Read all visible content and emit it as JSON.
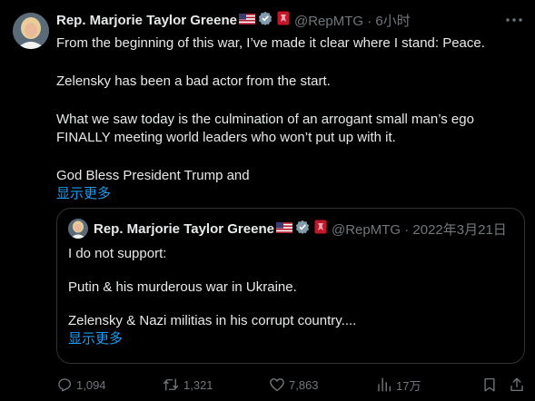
{
  "tweet": {
    "author_name": "Rep. Marjorie Taylor Greene",
    "flag_emoji": "🇺🇸",
    "handle": "@RepMTG",
    "separator": " · ",
    "time": "6小时",
    "text_lines": [
      "From the beginning of this war, I’ve made it clear where I stand: Peace.",
      "Zelensky has been a bad actor from the start.",
      "What we saw today is the culmination of an arrogant small man’s ego FINALLY meeting world leaders who won’t put up with it.",
      "God Bless President Trump and"
    ],
    "show_more": "显示更多"
  },
  "quoted": {
    "author_name": "Rep. Marjorie Taylor Greene",
    "flag_emoji": "🇺🇸",
    "handle": "@RepMTG",
    "separator": " · ",
    "date": "2022年3月21日",
    "text_lines": [
      "I do not support:",
      "Putin & his murderous war in Ukraine.",
      "Zelensky & Nazi militias in his corrupt country...."
    ],
    "show_more": "显示更多"
  },
  "actions": {
    "replies": "1,094",
    "reposts": "1,321",
    "likes": "7,863",
    "views": "17万"
  },
  "icons": {
    "verified": "verified-badge-icon",
    "gov": "government-label-icon",
    "more": "more-options-icon",
    "reply": "reply-icon",
    "repost": "repost-icon",
    "like": "heart-icon",
    "views": "views-chart-icon",
    "bookmark": "bookmark-icon",
    "share": "share-icon"
  },
  "colors": {
    "background": "#000000",
    "text": "#e7e9ea",
    "muted": "#71767b",
    "link": "#1d9bf0",
    "border": "#2f3336",
    "verified": "#829aab",
    "gov_badge": "#c2172a"
  }
}
